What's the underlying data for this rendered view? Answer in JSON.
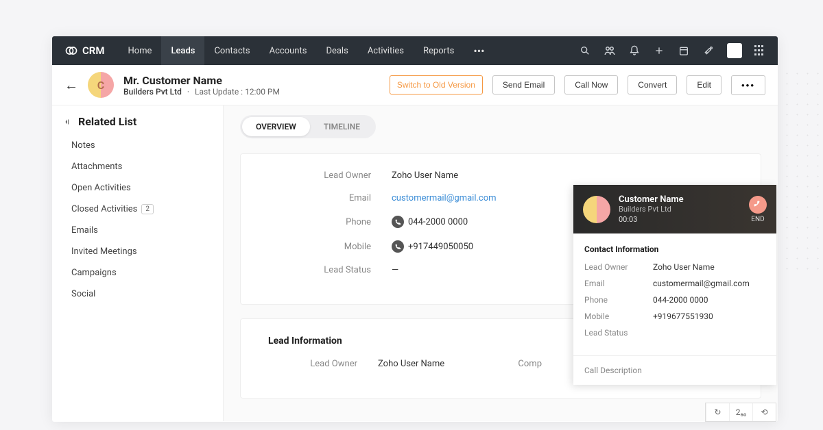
{
  "brand": {
    "name": "CRM"
  },
  "nav": {
    "tabs": [
      "Home",
      "Leads",
      "Contacts",
      "Accounts",
      "Deals",
      "Activities",
      "Reports"
    ],
    "active": "Leads"
  },
  "header": {
    "lead_name": "Mr. Customer Name",
    "company": "Builders Pvt Ltd",
    "last_update_label": "Last Update : 12:00 PM",
    "avatar_initial": "C",
    "switch_old_label": "Switch to Old Version",
    "send_email_label": "Send Email",
    "call_now_label": "Call Now",
    "convert_label": "Convert",
    "edit_label": "Edit"
  },
  "sidebar": {
    "title": "Related List",
    "items": [
      {
        "label": "Notes"
      },
      {
        "label": "Attachments"
      },
      {
        "label": "Open Activities"
      },
      {
        "label": "Closed Activities",
        "badge": "2"
      },
      {
        "label": "Emails"
      },
      {
        "label": "Invited Meetings"
      },
      {
        "label": "Campaigns"
      },
      {
        "label": "Social"
      }
    ]
  },
  "pill_tabs": {
    "overview": "OVERVIEW",
    "timeline": "TIMELINE"
  },
  "overview_card": {
    "fields": [
      {
        "label": "Lead Owner",
        "value": "Zoho User Name"
      },
      {
        "label": "Email",
        "value": "customermail@gmail.com",
        "link": true
      },
      {
        "label": "Phone",
        "value": "044-2000 0000",
        "phone": true
      },
      {
        "label": "Mobile",
        "value": "+917449050050",
        "phone": true
      },
      {
        "label": "Lead Status",
        "value": "—"
      }
    ]
  },
  "lead_info_section": {
    "title": "Lead Information",
    "fields": [
      {
        "label": "Lead Owner",
        "value": "Zoho User Name"
      },
      {
        "label": "Comp",
        "value": ""
      }
    ]
  },
  "call_popup": {
    "name": "Customer Name",
    "company": "Builders Pvt Ltd",
    "timer": "00:03",
    "end_label": "END",
    "contact_info_title": "Contact Information",
    "fields": [
      {
        "label": "Lead Owner",
        "value": "Zoho User Name"
      },
      {
        "label": "Email",
        "value": "customermail@gmail.com"
      },
      {
        "label": "Phone",
        "value": "044-2000 0000"
      },
      {
        "label": "Mobile",
        "value": "+919677551930"
      },
      {
        "label": "Lead Status",
        "value": ""
      }
    ],
    "description_placeholder": "Call Description"
  },
  "dock": {
    "item1": "↻",
    "item2": "2₆₀",
    "item3": "⟲"
  }
}
